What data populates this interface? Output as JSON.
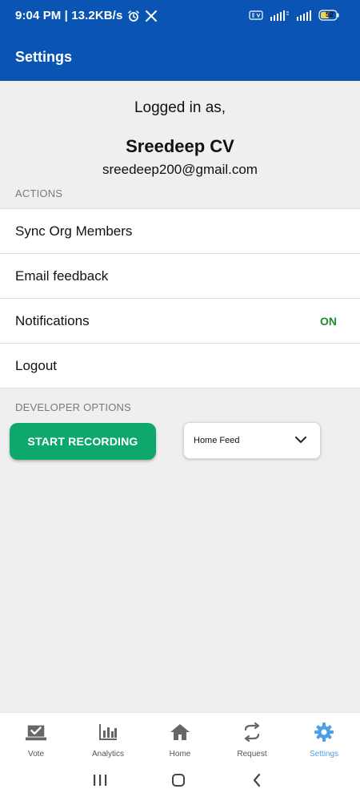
{
  "status_bar": {
    "time_and_speed": "9:04 PM | 13.2KB/s",
    "battery": "52"
  },
  "app_bar": {
    "title": "Settings"
  },
  "profile": {
    "logged_in_label": "Logged in as,",
    "name": "Sreedeep CV",
    "email": "sreedeep200@gmail.com"
  },
  "sections": {
    "actions": "ACTIONS",
    "developer": "DEVELOPER OPTIONS"
  },
  "actions": [
    {
      "label": "Sync Org Members"
    },
    {
      "label": "Email feedback"
    },
    {
      "label": "Notifications",
      "status": "ON"
    },
    {
      "label": "Logout"
    }
  ],
  "developer": {
    "record_button": "START RECORDING",
    "dropdown_value": "Home Feed"
  },
  "nav": [
    {
      "label": "Vote",
      "icon": "vote-icon"
    },
    {
      "label": "Analytics",
      "icon": "analytics-icon"
    },
    {
      "label": "Home",
      "icon": "home-icon"
    },
    {
      "label": "Request",
      "icon": "request-icon"
    },
    {
      "label": "Settings",
      "icon": "settings-icon",
      "active": true
    }
  ],
  "colors": {
    "app_bar": "#0a55b3",
    "accent_active": "#4e9fe7",
    "record_button": "#0fa86c",
    "status_on": "#1f8a2b"
  }
}
